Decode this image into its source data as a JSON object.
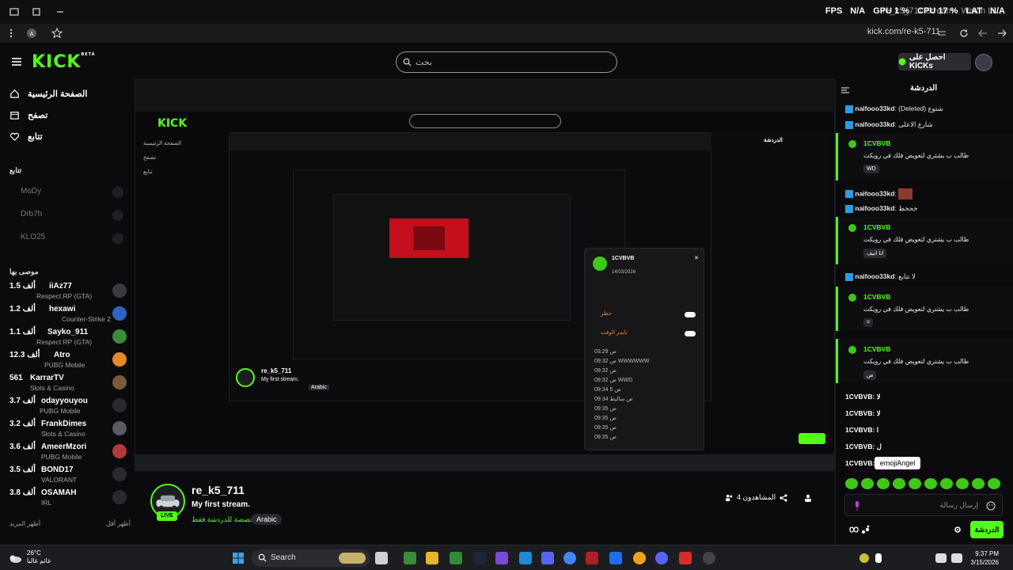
{
  "browser": {
    "tab_title": "re_k5_711 Stream - Watch Li...",
    "address": "kick.com/re-k5-711",
    "overlay": {
      "fps_label": "FPS",
      "fps_value": "N/A",
      "gpu": "GPU 1 %",
      "cpu": "CPU 17 %",
      "lat_label": "LAT",
      "lat_value": "N/A"
    }
  },
  "header": {
    "logo": "KICK",
    "logo_sup": "BETA",
    "search_placeholder": "بحث",
    "kicks_button": "احصل على KICKs"
  },
  "sidebar": {
    "nav": [
      {
        "label": "الصفحة الرئيسية",
        "icon": "home-icon"
      },
      {
        "label": "تصفح",
        "icon": "browse-icon"
      },
      {
        "label": "تتابع",
        "icon": "heart-icon"
      }
    ],
    "following_title": "تتابع",
    "following": [
      "MoDy",
      "Drb7h",
      "KLO25"
    ],
    "recommended_title": "موصى بها",
    "recommended": [
      {
        "count": "1.5 ألف",
        "name": "iiAz77",
        "game": "Respect RP (GTA)",
        "color": "#3a3a3f"
      },
      {
        "count": "1.2 ألف",
        "name": "hexawi",
        "game": "Counter-Strike 2",
        "color": "#2f63c8"
      },
      {
        "count": "1.1 ألف",
        "name": "Sayko_911",
        "game": "Respect RP (GTA)",
        "color": "#3d8a3b"
      },
      {
        "count": "12.3 ألف",
        "name": "Atro",
        "game": "PUBG Mobile",
        "color": "#e38a2a"
      },
      {
        "count": "561",
        "name": "KarrarTV",
        "game": "Slots & Casino",
        "color": "#7a5a3a"
      },
      {
        "count": "3.7 ألف",
        "name": "odayyouyou",
        "game": "PUBG Mobile",
        "color": "#2a2a2e"
      },
      {
        "count": "3.2 ألف",
        "name": "FrankDimes",
        "game": "Slots & Casino",
        "color": "#5a5a60"
      },
      {
        "count": "3.6 ألف",
        "name": "AmeerMzori",
        "game": "PUBG Mobile",
        "color": "#b23a3a"
      },
      {
        "count": "3.5 ألف",
        "name": "BOND17",
        "game": "VALORANT",
        "color": "#2a2a2e"
      },
      {
        "count": "3.8 ألف",
        "name": "OSAMAH",
        "game": "IRL",
        "color": "#2a2a2e"
      }
    ],
    "show_more": "أظهر المزيد",
    "show_less": "أظهر أقل"
  },
  "stream": {
    "streamer": "re_k5_711",
    "title": "My first stream.",
    "category": "مخصصة للدردشة فقط",
    "language": "Arabic",
    "live_badge": "LIVE",
    "viewers": "المشاهدون 4"
  },
  "nested": {
    "streamer": "re_k5_711",
    "title": "My first stream.",
    "language": "Arabic",
    "popup_user": "1CVBVB",
    "popup_date": "14/03/2026",
    "popup_items": [
      "حظر",
      "تايمر الوقت"
    ],
    "popup_log": [
      "03:29 ص",
      "09:32 ص WWWWWW",
      "09:32 ص",
      "09:32 ص WWD",
      "09:34 ص 5",
      "09:34 ص ساليط",
      "09:35 ص",
      "09:35 ص",
      "09:35 ص",
      "09:35 ص"
    ]
  },
  "chat": {
    "title": "الدردشة",
    "messages": [
      {
        "user": "naifooo33kd",
        "text": ": (Deleted) شتوع"
      },
      {
        "user": "naifooo33kd",
        "text": ": شارع الاعلى"
      }
    ],
    "bubbles": [
      {
        "user": "1CVBVB",
        "text": "طالب ب يشتري لتعويض فلك في رويكت",
        "tag": "WD"
      },
      {
        "user": "1CVBVB",
        "text": "طالب ب يشتري لتعويض فلك في رويكت",
        "tag": "اتا اتيف"
      },
      {
        "user": "1CVBVB",
        "text": "طالب ب يشتري لتعويض فلك في رويكت",
        "tag": "="
      },
      {
        "user": "1CVBVB",
        "text": "طالب ب يشتري لتعويض فلك في رويكت",
        "tag": "ص"
      }
    ],
    "mid_messages": [
      {
        "user": "naifooo33kd",
        "text": ":"
      },
      {
        "user": "naifooo33kd",
        "text": ": خحخط"
      },
      {
        "user": "naifooo33kd",
        "text": ": لا تتابع"
      }
    ],
    "short_messages": [
      {
        "user": "1CVBVB",
        "text": ": لا"
      },
      {
        "user": "1CVBVB",
        "text": ": لا"
      },
      {
        "user": "1CVBVB",
        "text": ": ا"
      },
      {
        "user": "1CVBVB",
        "text": ": ل"
      },
      {
        "user": "1CVBVB",
        "text": ":"
      }
    ],
    "tooltip": "emojiAngel",
    "input_placeholder": "إرسال رسالة",
    "send_label": "الدردشة"
  },
  "taskbar": {
    "weather_temp": "26°C",
    "weather_desc": "غائم غالبا",
    "search": "Search",
    "time": "9:37 PM",
    "date": "3/15/2026"
  },
  "colors": {
    "accent": "#53fc18",
    "background": "#0b0b0d"
  }
}
